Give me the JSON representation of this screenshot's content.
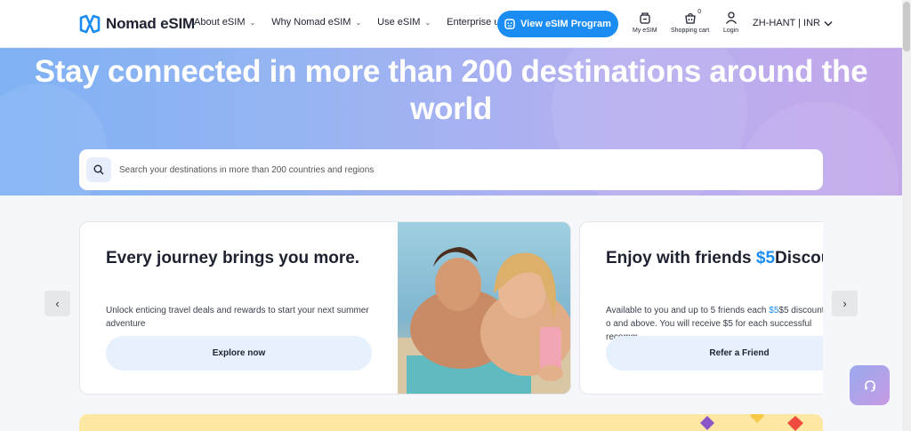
{
  "brand": {
    "name": "Nomad eSIM"
  },
  "nav": [
    {
      "label": "About eSIM",
      "has_menu": true
    },
    {
      "label": "Why Nomad eSIM",
      "has_menu": true
    },
    {
      "label": "Use eSIM",
      "has_menu": true
    },
    {
      "label": "Enterprise users",
      "has_menu": false
    }
  ],
  "header": {
    "cta_label": "View eSIM Program",
    "my_esim": "My eSIM",
    "cart": "Shopping cart",
    "cart_count": "0",
    "login": "Login",
    "lang": "ZH-HANT | INR"
  },
  "hero": {
    "title": "Stay connected in more than 200 destinations around the world",
    "search_placeholder": "Search your destinations in more than 200 countries and regions"
  },
  "carousel": {
    "prev": "‹",
    "next": "›",
    "cards": [
      {
        "title": "Every journey brings you more.",
        "desc": "Unlock enticing travel deals and rewards to start your next summer adventure",
        "button": "Explore now"
      },
      {
        "title_prefix": "Enjoy with friends ",
        "title_accent": "$5",
        "title_suffix": "Discou",
        "desc_prefix": "Available to you and up to 5 friends each ",
        "desc_accent": "$5",
        "desc_suffix": "$5 discount o and above. You will receive $5 for each successful recomm",
        "button": "Refer a Friend"
      }
    ]
  },
  "colors": {
    "accent": "#1a8cf2",
    "hero_start": "#7fb2f4",
    "hero_end": "#c3a8ea",
    "banner": "#fde8a3"
  }
}
